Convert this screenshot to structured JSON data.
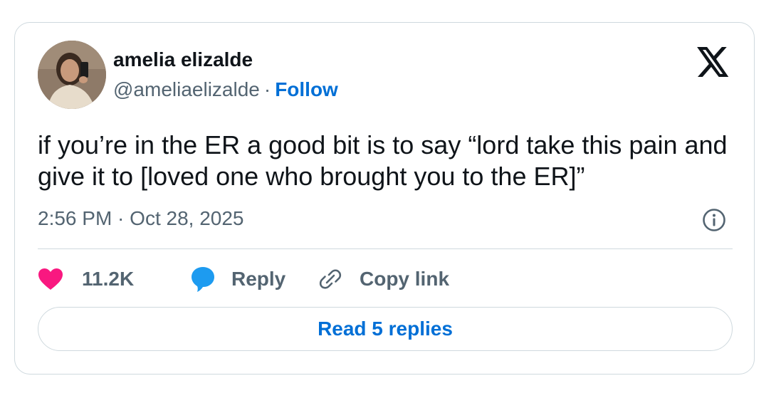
{
  "author": {
    "name": "amelia elizalde",
    "handle": "@ameliaelizalde",
    "separator": "·",
    "follow_label": "Follow"
  },
  "tweet": {
    "text": "if you’re in the ER a good bit is to say “lord take this pain and give it to [loved one who brought you to the ER]”",
    "timestamp": "2:56 PM · Oct 28, 2025"
  },
  "actions": {
    "likes_count": "11.2K",
    "reply_label": "Reply",
    "copy_link_label": "Copy link"
  },
  "read_replies_label": "Read 5 replies",
  "icons": {
    "brand": "x-logo-icon",
    "info": "info-icon",
    "like": "heart-icon",
    "reply": "speech-bubble-icon",
    "copy": "link-icon"
  },
  "colors": {
    "text": "#0f1419",
    "secondary": "#536471",
    "link": "#006fd6",
    "heart": "#f91880",
    "reply_bubble": "#1d9bf0",
    "border": "#cfd9de"
  }
}
